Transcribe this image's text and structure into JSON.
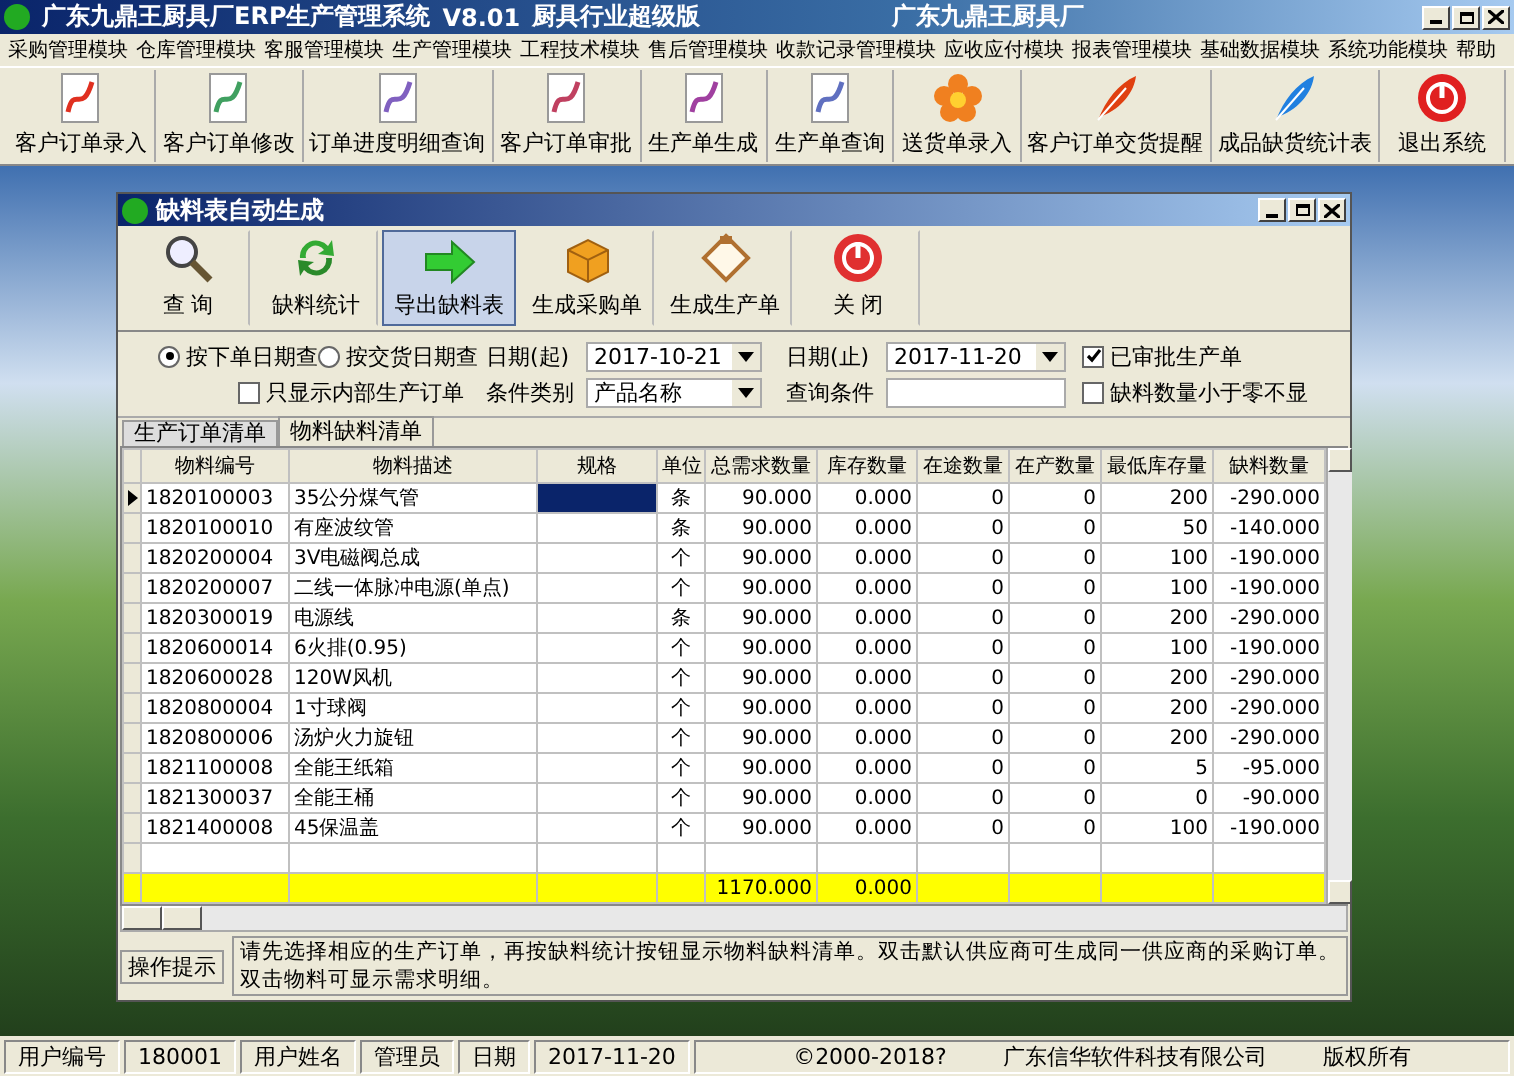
{
  "window": {
    "title": "广东九鼎王厨具厂ERP生产管理系统",
    "version": "V8.01",
    "edition": "厨具行业超级版",
    "company": "广东九鼎王厨具厂"
  },
  "menu": [
    "采购管理模块",
    "仓库管理模块",
    "客服管理模块",
    "生产管理模块",
    "工程技术模块",
    "售后管理模块",
    "收款记录管理模块",
    "应收应付模块",
    "报表管理模块",
    "基础数据模块",
    "系统功能模块",
    "帮助"
  ],
  "toolbar": [
    "客户订单录入",
    "客户订单修改",
    "订单进度明细查询",
    "客户订单审批",
    "生产单生成",
    "生产单查询",
    "送货单录入",
    "客户订单交货提醒",
    "成品缺货统计表",
    "退出系统"
  ],
  "child_window": {
    "title": "缺料表自动生成",
    "toolbar": [
      {
        "label": "查 询",
        "selected": false
      },
      {
        "label": "缺料统计",
        "selected": false
      },
      {
        "label": "导出缺料表",
        "selected": true
      },
      {
        "label": "生成采购单",
        "selected": false
      },
      {
        "label": "生成生产单",
        "selected": false
      },
      {
        "label": "关 闭",
        "selected": false
      }
    ],
    "filters": {
      "radios": [
        {
          "label": "按下单日期查",
          "selected": true
        },
        {
          "label": "按交货日期查",
          "selected": false
        }
      ],
      "internal_only": {
        "label": "只显示内部生产订单",
        "checked": false
      },
      "date_from": {
        "label": "日期(起)",
        "value": "2017-10-21"
      },
      "date_to": {
        "label": "日期(止)",
        "value": "2017-11-20"
      },
      "condition_type": {
        "label": "条件类别",
        "value": "产品名称"
      },
      "condition": {
        "label": "查询条件"
      },
      "approved_only": {
        "label": "已审批生产单",
        "checked": true
      },
      "hide_negative": {
        "label": "缺料数量小于零不显",
        "checked": false
      }
    },
    "tabs": [
      {
        "label": "生产订单清单",
        "selected": false
      },
      {
        "label": "物料缺料清单",
        "selected": true
      }
    ],
    "table": {
      "columns": [
        "物料编号",
        "物料描述",
        "规格",
        "单位",
        "总需求数量",
        "库存数量",
        "在途数量",
        "在产数量",
        "最低库存量",
        "缺料数量"
      ],
      "rows": [
        {
          "selected": true,
          "code": "1820100003",
          "description": "35公分煤气管",
          "unit": "条",
          "total_demand": "90.000",
          "stock": "0.000",
          "in_transit": "0",
          "in_production": "0",
          "min_stock": "200",
          "shortage": "-290.000"
        },
        {
          "selected": false,
          "code": "1820100010",
          "description": "有座波纹管",
          "unit": "条",
          "total_demand": "90.000",
          "stock": "0.000",
          "in_transit": "0",
          "in_production": "0",
          "min_stock": "50",
          "shortage": "-140.000"
        },
        {
          "selected": false,
          "code": "1820200004",
          "description": "3V电磁阀总成",
          "unit": "个",
          "total_demand": "90.000",
          "stock": "0.000",
          "in_transit": "0",
          "in_production": "0",
          "min_stock": "100",
          "shortage": "-190.000"
        },
        {
          "selected": false,
          "code": "1820200007",
          "description": "二线一体脉冲电源(单点)",
          "unit": "个",
          "total_demand": "90.000",
          "stock": "0.000",
          "in_transit": "0",
          "in_production": "0",
          "min_stock": "100",
          "shortage": "-190.000"
        },
        {
          "selected": false,
          "code": "1820300019",
          "description": "电源线",
          "unit": "条",
          "total_demand": "90.000",
          "stock": "0.000",
          "in_transit": "0",
          "in_production": "0",
          "min_stock": "200",
          "shortage": "-290.000"
        },
        {
          "selected": false,
          "code": "1820600014",
          "description": "6火排(0.95)",
          "unit": "个",
          "total_demand": "90.000",
          "stock": "0.000",
          "in_transit": "0",
          "in_production": "0",
          "min_stock": "100",
          "shortage": "-190.000"
        },
        {
          "selected": false,
          "code": "1820600028",
          "description": "120W风机",
          "unit": "个",
          "total_demand": "90.000",
          "stock": "0.000",
          "in_transit": "0",
          "in_production": "0",
          "min_stock": "200",
          "shortage": "-290.000"
        },
        {
          "selected": false,
          "code": "1820800004",
          "description": "1寸球阀",
          "unit": "个",
          "total_demand": "90.000",
          "stock": "0.000",
          "in_transit": "0",
          "in_production": "0",
          "min_stock": "200",
          "shortage": "-290.000"
        },
        {
          "selected": false,
          "code": "1820800006",
          "description": "汤炉火力旋钮",
          "unit": "个",
          "total_demand": "90.000",
          "stock": "0.000",
          "in_transit": "0",
          "in_production": "0",
          "min_stock": "200",
          "shortage": "-290.000"
        },
        {
          "selected": false,
          "code": "1821100008",
          "description": "全能王纸箱",
          "unit": "个",
          "total_demand": "90.000",
          "stock": "0.000",
          "in_transit": "0",
          "in_production": "0",
          "min_stock": "5",
          "shortage": "-95.000"
        },
        {
          "selected": false,
          "code": "1821300037",
          "description": "全能王桶",
          "unit": "个",
          "total_demand": "90.000",
          "stock": "0.000",
          "in_transit": "0",
          "in_production": "0",
          "min_stock": "0",
          "shortage": "-90.000"
        },
        {
          "selected": false,
          "code": "1821400008",
          "description": "45保温盖",
          "unit": "个",
          "total_demand": "90.000",
          "stock": "0.000",
          "in_transit": "0",
          "in_production": "0",
          "min_stock": "100",
          "shortage": "-190.000"
        }
      ],
      "totals": {
        "total_demand": "1170.000",
        "stock": "0.000"
      }
    },
    "hint": {
      "label": "操作提示",
      "text": "请先选择相应的生产订单，再按缺料统计按钮显示物料缺料清单。双击默认供应商可生成同一供应商的采购订单。双击物料可显示需求明细。"
    }
  },
  "status_bar": {
    "fields": [
      {
        "label": "用户编号",
        "value": "180001"
      },
      {
        "label": "用户姓名",
        "value": "管理员"
      },
      {
        "label": "日期",
        "value": "2017-11-20"
      }
    ],
    "copyright": [
      "©2000-2018?",
      "广东信华软件科技有限公司",
      "版权所有"
    ]
  }
}
